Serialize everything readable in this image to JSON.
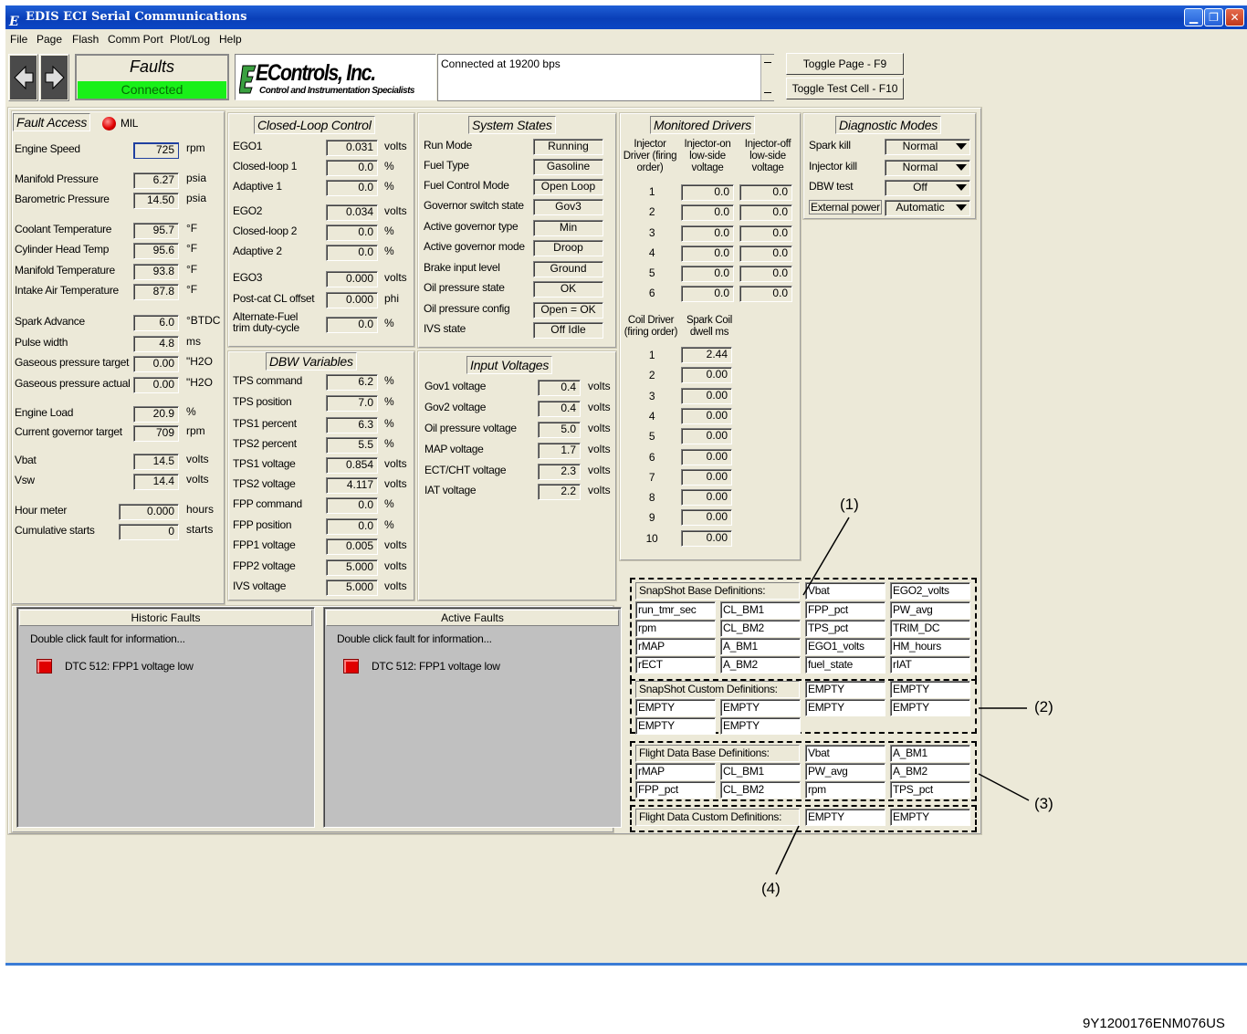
{
  "window": {
    "title": "EDIS ECI Serial Communications",
    "logo_glyph": "E"
  },
  "menu": [
    "File",
    "Page",
    "Flash",
    "Comm Port",
    "Plot/Log",
    "Help"
  ],
  "toolbar": {
    "faults_label": "Faults",
    "connection_state": "Connected",
    "company_name": "EControls, Inc.",
    "company_tagline": "Control and Instrumentation Specialists",
    "status_message": "Connected at 19200 bps",
    "toggle_page": "Toggle Page - F9",
    "toggle_test_cell": "Toggle Test Cell - F10"
  },
  "fault_access": {
    "title": "Fault Access",
    "mil_label": "MIL",
    "rows": [
      {
        "label": "Engine Speed",
        "value": "725",
        "unit": "rpm"
      },
      {
        "label": "Manifold Pressure",
        "value": "6.27",
        "unit": "psia"
      },
      {
        "label": "Barometric Pressure",
        "value": "14.50",
        "unit": "psia"
      },
      {
        "label": "Coolant Temperature",
        "value": "95.7",
        "unit": "°F"
      },
      {
        "label": "Cylinder Head Temp",
        "value": "95.6",
        "unit": "°F"
      },
      {
        "label": "Manifold Temperature",
        "value": "93.8",
        "unit": "°F"
      },
      {
        "label": "Intake Air Temperature",
        "value": "87.8",
        "unit": "°F"
      },
      {
        "label": "Spark Advance",
        "value": "6.0",
        "unit": "°BTDC"
      },
      {
        "label": "Pulse width",
        "value": "4.8",
        "unit": "ms"
      },
      {
        "label": "Gaseous pressure target",
        "value": "0.00",
        "unit": "\"H2O"
      },
      {
        "label": "Gaseous pressure actual",
        "value": "0.00",
        "unit": "\"H2O"
      },
      {
        "label": "Engine Load",
        "value": "20.9",
        "unit": "%"
      },
      {
        "label": "Current governor target",
        "value": "709",
        "unit": "rpm"
      },
      {
        "label": "Vbat",
        "value": "14.5",
        "unit": "volts"
      },
      {
        "label": "Vsw",
        "value": "14.4",
        "unit": "volts"
      },
      {
        "label": "Hour meter",
        "value": "0.000",
        "unit": "hours"
      },
      {
        "label": "Cumulative starts",
        "value": "0",
        "unit": "starts"
      }
    ]
  },
  "closed_loop": {
    "title": "Closed-Loop Control",
    "rows": [
      {
        "label": "EGO1",
        "value": "0.031",
        "unit": "volts"
      },
      {
        "label": "Closed-loop 1",
        "value": "0.0",
        "unit": "%"
      },
      {
        "label": "Adaptive 1",
        "value": "0.0",
        "unit": "%"
      },
      {
        "label": "EGO2",
        "value": "0.034",
        "unit": "volts"
      },
      {
        "label": "Closed-loop 2",
        "value": "0.0",
        "unit": "%"
      },
      {
        "label": "Adaptive 2",
        "value": "0.0",
        "unit": "%"
      },
      {
        "label": "EGO3",
        "value": "0.000",
        "unit": "volts"
      },
      {
        "label": "Post-cat CL offset",
        "value": "0.000",
        "unit": "phi"
      },
      {
        "label": "Alternate-Fuel trim duty-cycle",
        "value": "0.0",
        "unit": "%"
      }
    ]
  },
  "dbw": {
    "title": "DBW Variables",
    "rows": [
      {
        "label": "TPS command",
        "value": "6.2",
        "unit": "%"
      },
      {
        "label": "TPS position",
        "value": "7.0",
        "unit": "%"
      },
      {
        "label": "TPS1 percent",
        "value": "6.3",
        "unit": "%"
      },
      {
        "label": "TPS2 percent",
        "value": "5.5",
        "unit": "%"
      },
      {
        "label": "TPS1 voltage",
        "value": "0.854",
        "unit": "volts"
      },
      {
        "label": "TPS2 voltage",
        "value": "4.117",
        "unit": "volts"
      },
      {
        "label": "FPP command",
        "value": "0.0",
        "unit": "%"
      },
      {
        "label": "FPP position",
        "value": "0.0",
        "unit": "%"
      },
      {
        "label": "FPP1 voltage",
        "value": "0.005",
        "unit": "volts"
      },
      {
        "label": "FPP2 voltage",
        "value": "5.000",
        "unit": "volts"
      },
      {
        "label": "IVS voltage",
        "value": "5.000",
        "unit": "volts"
      }
    ]
  },
  "system_states": {
    "title": "System States",
    "rows": [
      {
        "label": "Run Mode",
        "value": "Running"
      },
      {
        "label": "Fuel Type",
        "value": "Gasoline"
      },
      {
        "label": "Fuel Control Mode",
        "value": "Open Loop"
      },
      {
        "label": "Governor switch state",
        "value": "Gov3"
      },
      {
        "label": "Active governor type",
        "value": "Min"
      },
      {
        "label": "Active governor mode",
        "value": "Droop"
      },
      {
        "label": "Brake input level",
        "value": "Ground"
      },
      {
        "label": "Oil pressure state",
        "value": "OK"
      },
      {
        "label": "Oil pressure config",
        "value": "Open = OK"
      },
      {
        "label": "IVS state",
        "value": "Off Idle"
      }
    ]
  },
  "input_voltages": {
    "title": "Input Voltages",
    "rows": [
      {
        "label": "Gov1 voltage",
        "value": "0.4",
        "unit": "volts"
      },
      {
        "label": "Gov2 voltage",
        "value": "0.4",
        "unit": "volts"
      },
      {
        "label": "Oil pressure voltage",
        "value": "5.0",
        "unit": "volts"
      },
      {
        "label": "MAP voltage",
        "value": "1.7",
        "unit": "volts"
      },
      {
        "label": "ECT/CHT voltage",
        "value": "2.3",
        "unit": "volts"
      },
      {
        "label": "IAT voltage",
        "value": "2.2",
        "unit": "volts"
      }
    ]
  },
  "monitored_drivers": {
    "title": "Monitored Drivers",
    "inj_headers": [
      "Injector Driver (firing order)",
      "Injector-on low-side voltage",
      "Injector-off low-side voltage"
    ],
    "injectors": [
      {
        "n": "1",
        "on": "0.0",
        "off": "0.0"
      },
      {
        "n": "2",
        "on": "0.0",
        "off": "0.0"
      },
      {
        "n": "3",
        "on": "0.0",
        "off": "0.0"
      },
      {
        "n": "4",
        "on": "0.0",
        "off": "0.0"
      },
      {
        "n": "5",
        "on": "0.0",
        "off": "0.0"
      },
      {
        "n": "6",
        "on": "0.0",
        "off": "0.0"
      }
    ],
    "coil_headers": [
      "Coil Driver (firing order)",
      "Spark Coil dwell ms"
    ],
    "coils": [
      {
        "n": "1",
        "dwell": "2.44"
      },
      {
        "n": "2",
        "dwell": "0.00"
      },
      {
        "n": "3",
        "dwell": "0.00"
      },
      {
        "n": "4",
        "dwell": "0.00"
      },
      {
        "n": "5",
        "dwell": "0.00"
      },
      {
        "n": "6",
        "dwell": "0.00"
      },
      {
        "n": "7",
        "dwell": "0.00"
      },
      {
        "n": "8",
        "dwell": "0.00"
      },
      {
        "n": "9",
        "dwell": "0.00"
      },
      {
        "n": "10",
        "dwell": "0.00"
      }
    ]
  },
  "diagnostic": {
    "title": "Diagnostic Modes",
    "rows": [
      {
        "label": "Spark kill",
        "value": "Normal"
      },
      {
        "label": "Injector kill",
        "value": "Normal"
      },
      {
        "label": "DBW test",
        "value": "Off"
      },
      {
        "label": "External power",
        "value": "Automatic"
      }
    ]
  },
  "historic_faults": {
    "title": "Historic Faults",
    "hint": "Double click fault for information...",
    "items": [
      "DTC 512: FPP1 voltage low"
    ]
  },
  "active_faults": {
    "title": "Active Faults",
    "hint": "Double click fault for information...",
    "items": [
      "DTC 512: FPP1 voltage low"
    ]
  },
  "snapshot_base": {
    "label": "SnapShot Base Definitions:",
    "cells": [
      "Vbat",
      "EGO2_volts",
      "run_tmr_sec",
      "CL_BM1",
      "FPP_pct",
      "PW_avg",
      "rpm",
      "CL_BM2",
      "TPS_pct",
      "TRIM_DC",
      "rMAP",
      "A_BM1",
      "EGO1_volts",
      "HM_hours",
      "rECT",
      "A_BM2",
      "fuel_state",
      "rIAT"
    ]
  },
  "snapshot_custom": {
    "label": "SnapShot Custom Definitions:",
    "cells": [
      "EMPTY",
      "EMPTY",
      "EMPTY",
      "EMPTY",
      "EMPTY",
      "EMPTY",
      "EMPTY",
      "EMPTY"
    ]
  },
  "flight_base": {
    "label": "Flight Data Base Definitions:",
    "cells": [
      "Vbat",
      "A_BM1",
      "rMAP",
      "CL_BM1",
      "PW_avg",
      "A_BM2",
      "FPP_pct",
      "CL_BM2",
      "rpm",
      "TPS_pct"
    ]
  },
  "flight_custom": {
    "label": "Flight Data Custom Definitions:",
    "cells": [
      "EMPTY",
      "EMPTY"
    ]
  },
  "callouts": [
    "(1)",
    "(2)",
    "(3)",
    "(4)"
  ],
  "figure_id": "9Y1200176ENM076US"
}
